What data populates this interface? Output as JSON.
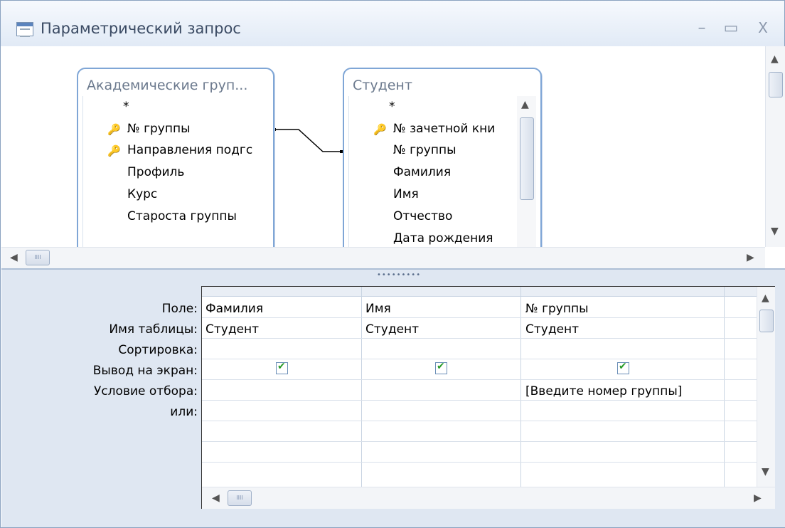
{
  "window": {
    "title": "Параметрический запрос"
  },
  "controls": {
    "minimize": "–",
    "maximize": "▭",
    "close": "X"
  },
  "tables": [
    {
      "title": "Академические груп...",
      "fields": [
        {
          "name": "*",
          "key": false
        },
        {
          "name": "№ группы",
          "key": true
        },
        {
          "name": "Направления подгс",
          "key": true
        },
        {
          "name": "Профиль",
          "key": false
        },
        {
          "name": "Курс",
          "key": false
        },
        {
          "name": "Староста группы",
          "key": false
        }
      ]
    },
    {
      "title": "Студент",
      "fields": [
        {
          "name": "*",
          "key": false
        },
        {
          "name": "№ зачетной кни",
          "key": true
        },
        {
          "name": "№ группы",
          "key": false
        },
        {
          "name": "Фамилия",
          "key": false
        },
        {
          "name": "Имя",
          "key": false
        },
        {
          "name": "Отчество",
          "key": false
        },
        {
          "name": "Дата рождения",
          "key": false
        }
      ]
    }
  ],
  "icons": {
    "key": "🔑",
    "up": "▲",
    "down": "▼",
    "left": "◀",
    "right": "▶",
    "grip": "IIII",
    "check": "✔",
    "splitter": "•••••••••"
  },
  "grid": {
    "row_labels": [
      "Поле:",
      "Имя таблицы:",
      "Сортировка:",
      "Вывод на экран:",
      "Условие отбора:",
      "или:"
    ],
    "columns": [
      {
        "field": "Фамилия",
        "table": "Студент",
        "sort": "",
        "show": true,
        "criteria": "",
        "or": ""
      },
      {
        "field": "Имя",
        "table": "Студент",
        "sort": "",
        "show": true,
        "criteria": "",
        "or": ""
      },
      {
        "field": "№ группы",
        "table": "Студент",
        "sort": "",
        "show": true,
        "criteria": "[Введите номер группы]",
        "or": ""
      }
    ]
  }
}
